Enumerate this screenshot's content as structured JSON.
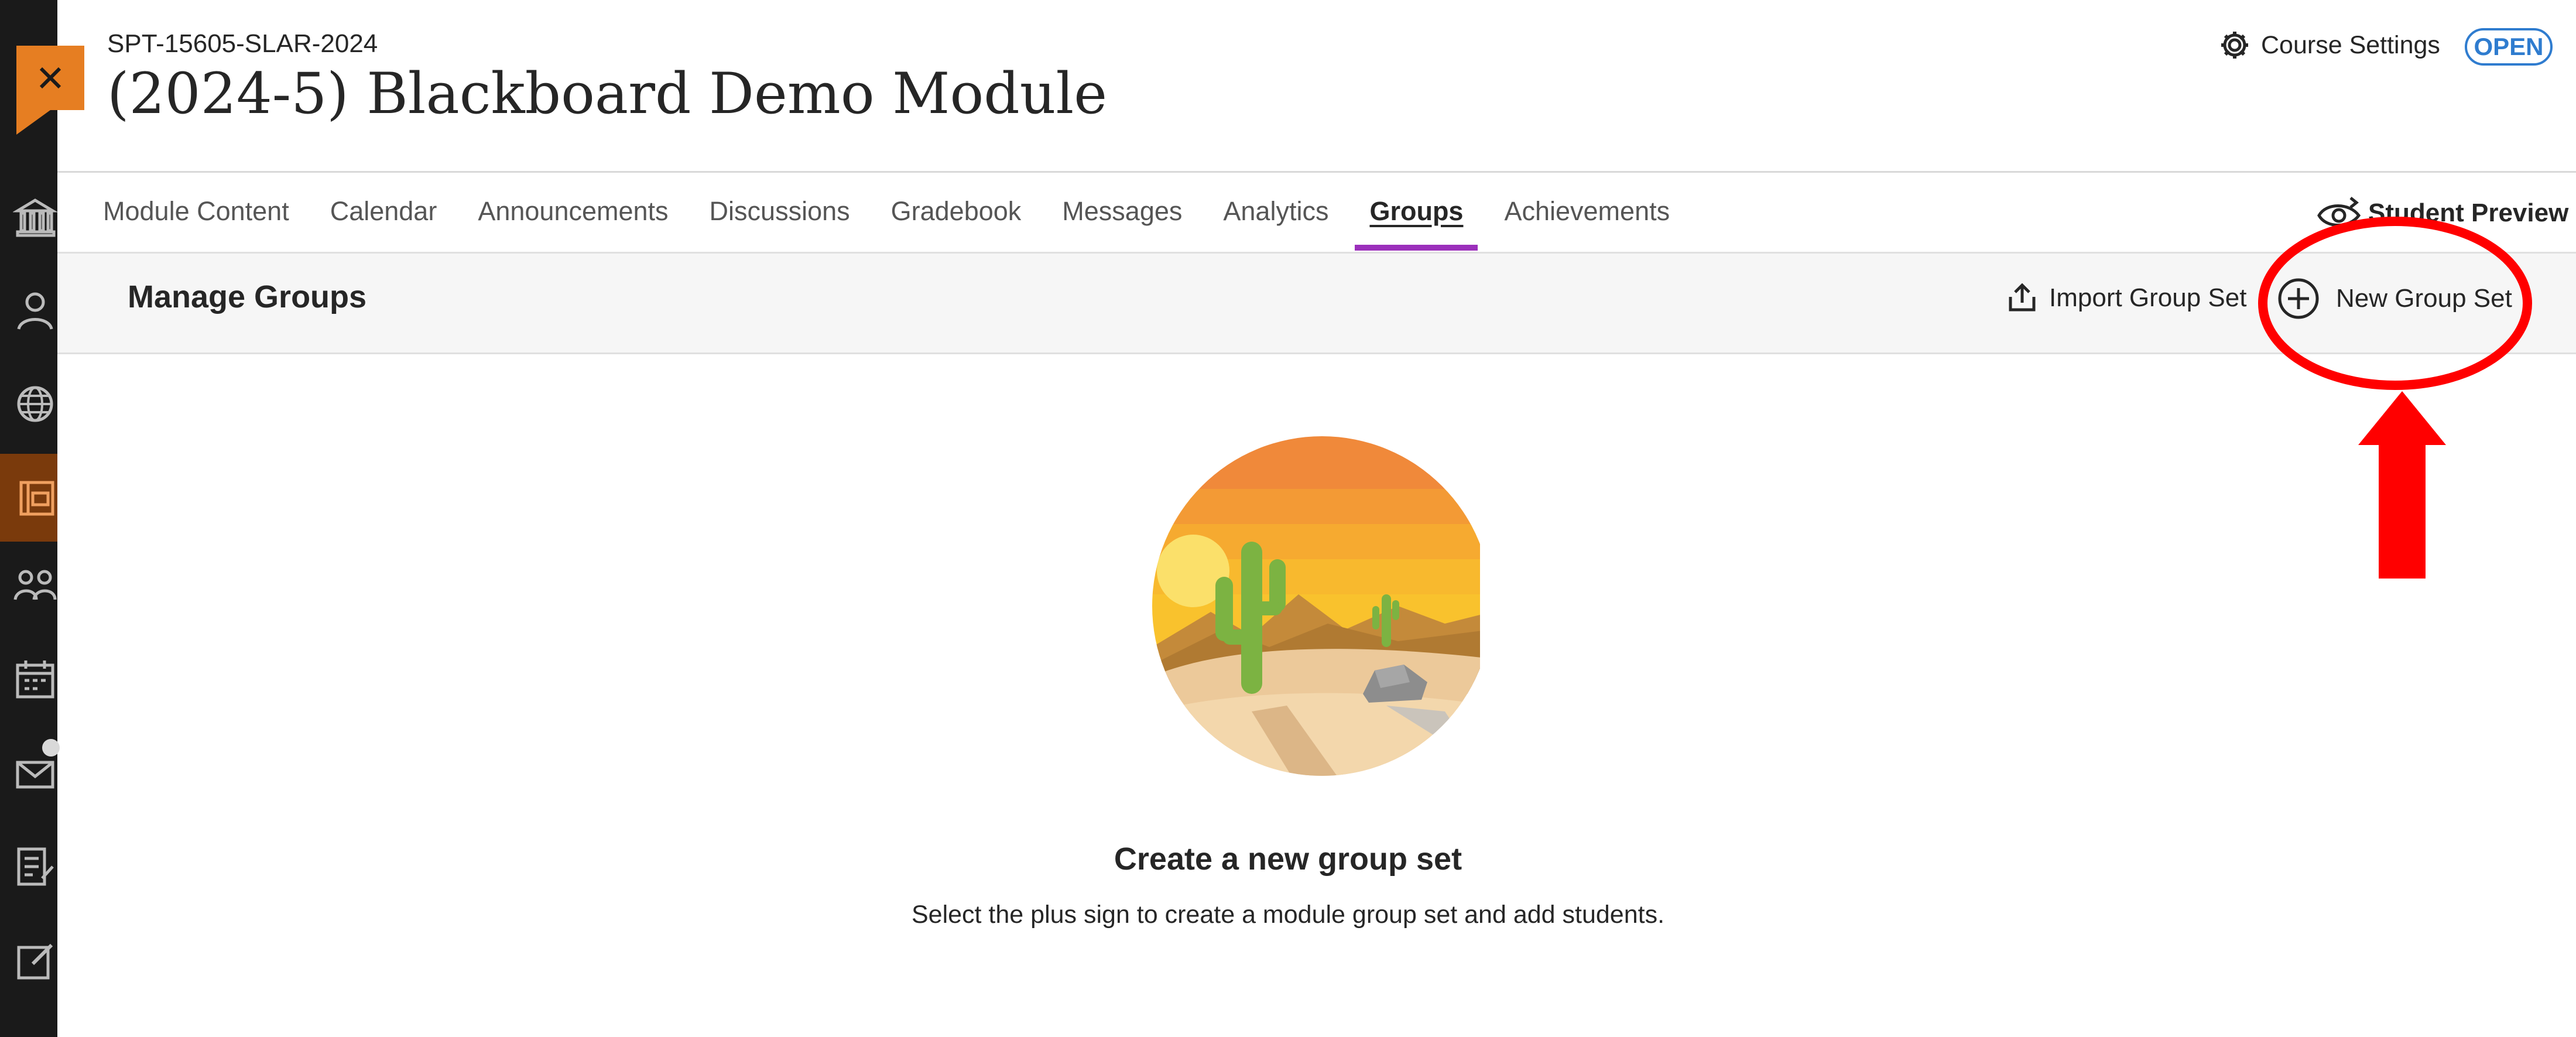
{
  "course": {
    "code": "SPT-15605-SLAR-2024",
    "title": "(2024-5) Blackboard Demo Module",
    "settings_label": "Course Settings",
    "status_badge": "OPEN"
  },
  "tabs": [
    {
      "label": "Module Content",
      "active": false
    },
    {
      "label": "Calendar",
      "active": false
    },
    {
      "label": "Announcements",
      "active": false
    },
    {
      "label": "Discussions",
      "active": false
    },
    {
      "label": "Gradebook",
      "active": false
    },
    {
      "label": "Messages",
      "active": false
    },
    {
      "label": "Analytics",
      "active": false
    },
    {
      "label": "Groups",
      "active": true
    },
    {
      "label": "Achievements",
      "active": false
    }
  ],
  "student_preview_label": "Student Preview",
  "manage": {
    "title": "Manage Groups",
    "import_label": "Import Group Set",
    "new_label": "New Group Set"
  },
  "empty_state": {
    "title": "Create a new group set",
    "description": "Select the plus sign to create a module group set and add students."
  },
  "rail_icons": [
    "institution-icon",
    "profile-icon",
    "globe-icon",
    "courses-icon",
    "groups-icon",
    "calendar-icon",
    "messages-icon",
    "grades-icon",
    "edit-icon"
  ],
  "colors": {
    "accent_orange": "#e67e22",
    "active_tab_underline": "#9b2fbb",
    "open_badge": "#2f7ccf",
    "annotation_red": "#ff0000",
    "rail_bg": "#1a1a1a"
  }
}
